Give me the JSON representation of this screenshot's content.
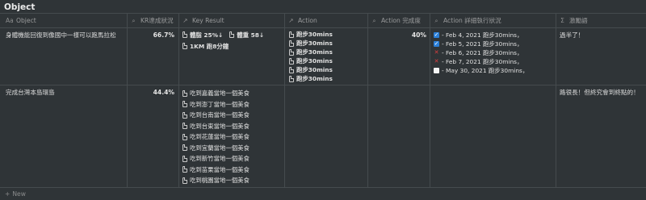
{
  "page": {
    "title": "Object"
  },
  "headers": [
    {
      "icon_name": "text-icon",
      "icon": "Aa",
      "label": "Object"
    },
    {
      "icon_name": "search-icon",
      "icon": "⌕",
      "label": "KR達成狀況"
    },
    {
      "icon_name": "arrow-up-right-icon",
      "icon": "↗",
      "label": "Key Result"
    },
    {
      "icon_name": "arrow-up-right-icon",
      "icon": "↗",
      "label": "Action"
    },
    {
      "icon_name": "search-icon",
      "icon": "⌕",
      "label": "Action 完成度"
    },
    {
      "icon_name": "search-icon",
      "icon": "⌕",
      "label": "Action 詳細執行狀況"
    },
    {
      "icon_name": "sigma-icon",
      "icon": "Σ",
      "label": "激勵語"
    }
  ],
  "rows": [
    {
      "object": "身體機能回復到像國中一樣可以跑馬拉松",
      "kr_status": "66.7%",
      "key_results": [
        "體脂 25%↓",
        "體重 58↓",
        "1KM 跑8分鐘"
      ],
      "actions": [
        "跑步30mins",
        "跑步30mins",
        "跑步30mins",
        "跑步30mins",
        "跑步30mins",
        "跑步30mins"
      ],
      "action_completion": "40%",
      "action_details": [
        {
          "state": "done",
          "mark": "✓",
          "text": "- Feb 4, 2021 跑步30mins，"
        },
        {
          "state": "done",
          "mark": "✓",
          "text": "- Feb 5, 2021 跑步30mins，"
        },
        {
          "state": "fail",
          "mark": "✕",
          "text": "- Feb 6, 2021 跑步30mins，"
        },
        {
          "state": "fail",
          "mark": "✕",
          "text": "- Feb 7, 2021 跑步30mins，"
        },
        {
          "state": "empty",
          "mark": "",
          "text": "- May 30, 2021 跑步30mins，"
        }
      ],
      "motivation": "過半了！"
    },
    {
      "object": "完成台灣本島環島",
      "kr_status": "44.4%",
      "key_results": [
        "吃到嘉義當地一個美食",
        "吃到澎丁當地一個美食",
        "吃到台南當地一個美食",
        "吃到台東當地一個美食",
        "吃到花蓮當地一個美食",
        "吃到宜蘭當地一個美食",
        "吃到新竹當地一個美食",
        "吃到苗栗當地一個美食",
        "吃到桃園當地一個美食"
      ],
      "actions": [],
      "action_completion": "",
      "action_details": [],
      "motivation": "路很長！但終究會到終點的！"
    }
  ],
  "footer": {
    "new_icon": "+",
    "new_label": "New"
  }
}
